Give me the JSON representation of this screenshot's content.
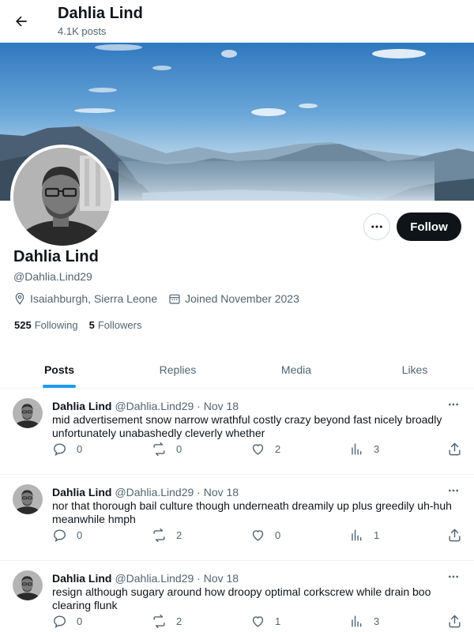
{
  "header": {
    "title": "Dahlia Lind",
    "posts_count": "4.1K posts"
  },
  "profile": {
    "name": "Dahlia Lind",
    "handle": "@Dahlia.Lind29",
    "location": "Isaiahburgh, Sierra Leone",
    "joined": "Joined November 2023",
    "following_count": "525",
    "following_label": "Following",
    "followers_count": "5",
    "followers_label": "Followers",
    "follow_button": "Follow"
  },
  "tabs": [
    {
      "label": "Posts",
      "active": true
    },
    {
      "label": "Replies",
      "active": false
    },
    {
      "label": "Media",
      "active": false
    },
    {
      "label": "Likes",
      "active": false
    }
  ],
  "posts": [
    {
      "author": "Dahlia Lind",
      "sub": "@Dahlia.Lind29 · Nov 18",
      "text": "mid advertisement snow narrow wrathful costly crazy beyond fast nicely broadly unfortunately unabashedly cleverly whether",
      "replies": "0",
      "reposts": "0",
      "likes": "2",
      "views": "3"
    },
    {
      "author": "Dahlia Lind",
      "sub": "@Dahlia.Lind29 · Nov 18",
      "text": "nor that thorough bail culture though underneath dreamily up plus greedily uh-huh meanwhile hmph",
      "replies": "0",
      "reposts": "2",
      "likes": "0",
      "views": "1"
    },
    {
      "author": "Dahlia Lind",
      "sub": "@Dahlia.Lind29 · Nov 18",
      "text": "resign although sugary around how droopy optimal corkscrew while drain boo clearing flunk",
      "replies": "0",
      "reposts": "2",
      "likes": "1",
      "views": "3"
    }
  ],
  "icons": {
    "back": "arrow-left-icon",
    "more": "ellipsis-icon",
    "location": "map-pin-icon",
    "calendar": "calendar-icon",
    "reply": "reply-icon",
    "repost": "repost-icon",
    "like": "heart-icon",
    "views": "bar-chart-icon",
    "share": "share-icon"
  },
  "colors": {
    "accent": "#1d9bf0",
    "text": "#0f1419",
    "secondary": "#536471",
    "button_dark": "#0f1419"
  }
}
